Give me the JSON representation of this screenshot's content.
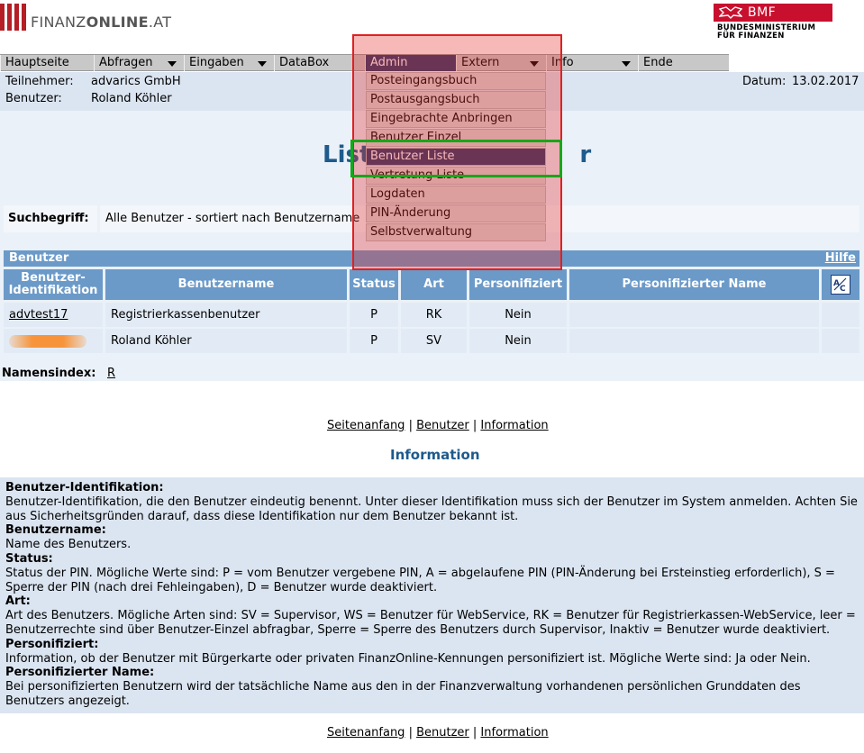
{
  "header": {
    "logo_prefix": "FINANZ",
    "logo_bold": "ONLINE",
    "logo_suffix": ".AT",
    "bmf_label": "BMF",
    "bmf_sub_line1": "BUNDESMINISTERIUM",
    "bmf_sub_line2": "FÜR FINANZEN"
  },
  "nav": {
    "items": [
      {
        "label": "Hauptseite"
      },
      {
        "label": "Abfragen"
      },
      {
        "label": "Eingaben"
      },
      {
        "label": "DataBox"
      },
      {
        "label": "Admin"
      },
      {
        "label": "Extern"
      },
      {
        "label": "Info"
      },
      {
        "label": "Ende"
      }
    ]
  },
  "infobar": {
    "participant_label": "Teilnehmer:",
    "participant_value": "advarics GmbH",
    "user_label": "Benutzer:",
    "user_value": "Roland Köhler",
    "date_label": "Datum:",
    "date_value": "13.02.2017"
  },
  "page": {
    "title_visible": "List",
    "title_end_visible": "r"
  },
  "search": {
    "label": "Suchbegriff:",
    "value": "Alle Benutzer - sortiert nach Benutzername"
  },
  "table": {
    "title": "Benutzer",
    "help": "Hilfe",
    "columns": [
      "Benutzer-Identifikation",
      "Benutzername",
      "Status",
      "Art",
      "Personifiziert",
      "Personifizierter Name"
    ],
    "sort_icon": "abc-sort-icon",
    "rows": [
      {
        "id": "advtest17",
        "username": "Registrierkassenbenutzer",
        "status": "P",
        "art": "RK",
        "personifiziert": "Nein",
        "name": ""
      },
      {
        "id": "",
        "username": "Roland Köhler",
        "status": "P",
        "art": "SV",
        "personifiziert": "Nein",
        "name": ""
      }
    ]
  },
  "name_index": {
    "label": "Namensindex:",
    "letter": "R"
  },
  "footer_links": [
    "Seitenanfang",
    "Benutzer",
    "Information"
  ],
  "information": {
    "heading": "Information",
    "entries": [
      {
        "term": "Benutzer-Identifikation:",
        "desc": "Benutzer-Identifikation, die den Benutzer eindeutig benennt. Unter dieser Identifikation muss sich der Benutzer im System anmelden. Achten Sie aus Sicherheitsgründen darauf, dass diese Identifikation nur dem Benutzer bekannt ist."
      },
      {
        "term": "Benutzername:",
        "desc": "Name des Benutzers."
      },
      {
        "term": "Status:",
        "desc": "Status der PIN. Mögliche Werte sind: P = vom Benutzer vergebene PIN, A = abgelaufene PIN (PIN-Änderung bei Ersteinstieg erforderlich), S = Sperre der PIN (nach drei Fehleingaben), D = Benutzer wurde deaktiviert."
      },
      {
        "term": "Art:",
        "desc": "Art des Benutzers. Mögliche Arten sind: SV = Supervisor, WS = Benutzer für WebService, RK = Benutzer für Registrierkassen-WebService, leer = Benutzerrechte sind über Benutzer-Einzel abfragbar, Sperre = Sperre des Benutzers durch Supervisor, Inaktiv = Benutzer wurde deaktiviert."
      },
      {
        "term": "Personifiziert:",
        "desc": "Information, ob der Benutzer mit Bürgerkarte oder privaten FinanzOnline-Kennungen personifiziert ist. Mögliche Werte sind: Ja oder Nein."
      },
      {
        "term": "Personifizierter Name:",
        "desc": "Bei personifizierten Benutzern wird der tatsächliche Name aus den in der Finanzverwaltung vorhandenen persönlichen Grunddaten des Benutzers angezeigt."
      }
    ]
  },
  "dropdown": {
    "items": [
      {
        "label": "Posteingangsbuch"
      },
      {
        "label": "Postausgangsbuch"
      },
      {
        "label": "Eingebrachte Anbringen"
      },
      {
        "label": "Benutzer Einzel"
      },
      {
        "label": "Benutzer Liste"
      },
      {
        "label": "Vertretung Liste"
      },
      {
        "label": "Logdaten"
      },
      {
        "label": "PIN-Änderung"
      },
      {
        "label": "Selbstverwaltung"
      }
    ]
  },
  "colors": {
    "nav_active": "#2d3c6b",
    "table_header": "#6b9ac8",
    "highlight_red": "#e02020",
    "highlight_green": "#19a619",
    "brand_red": "#c8102e"
  }
}
